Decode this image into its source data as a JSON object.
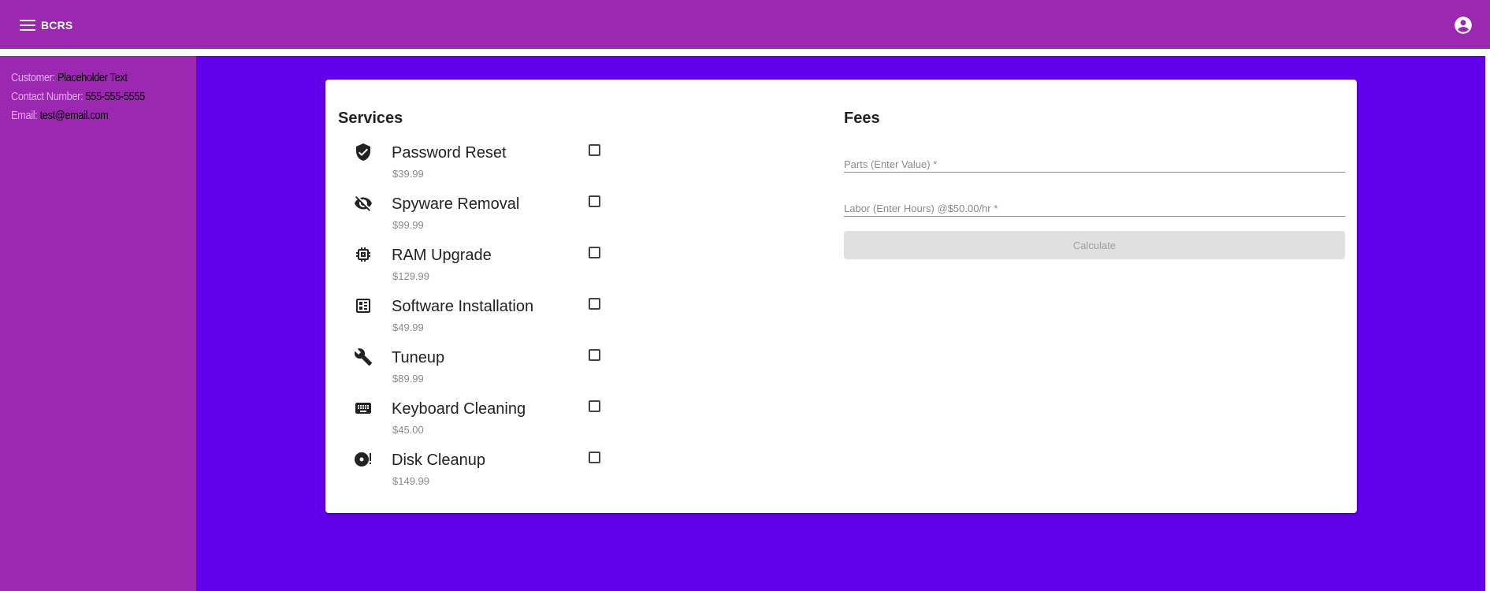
{
  "app": {
    "title": "BCRS"
  },
  "sidebar": {
    "customer_label": "Customer:",
    "customer_value": "Placeholder Text",
    "contact_label": "Contact Number:",
    "contact_value": "555-555-5555",
    "email_label": "Email:",
    "email_value": "test@email.com"
  },
  "services": {
    "title": "Services",
    "items": [
      {
        "name": "Password Reset",
        "price": "$39.99",
        "icon": "shield-check-icon",
        "checked": false
      },
      {
        "name": "Spyware Removal",
        "price": "$99.99",
        "icon": "eye-off-icon",
        "checked": false
      },
      {
        "name": "RAM Upgrade",
        "price": "$129.99",
        "icon": "memory-chip-icon",
        "checked": false
      },
      {
        "name": "Software Installation",
        "price": "$49.99",
        "icon": "software-installer-icon",
        "checked": false
      },
      {
        "name": "Tuneup",
        "price": "$89.99",
        "icon": "wrench-icon",
        "checked": false
      },
      {
        "name": "Keyboard Cleaning",
        "price": "$45.00",
        "icon": "keyboard-icon",
        "checked": false
      },
      {
        "name": "Disk Cleanup",
        "price": "$149.99",
        "icon": "disk-icon",
        "checked": false
      }
    ]
  },
  "fees": {
    "title": "Fees",
    "parts_placeholder": "Parts (Enter Value) *",
    "labor_placeholder": "Labor (Enter Hours) @$50.00/hr *",
    "calculate_label": "Calculate"
  },
  "colors": {
    "toolbar": "#9c27b0",
    "sidebar": "#9c27b0",
    "main_background": "#6200ea",
    "sidebar_label": "#e1aaf5"
  }
}
